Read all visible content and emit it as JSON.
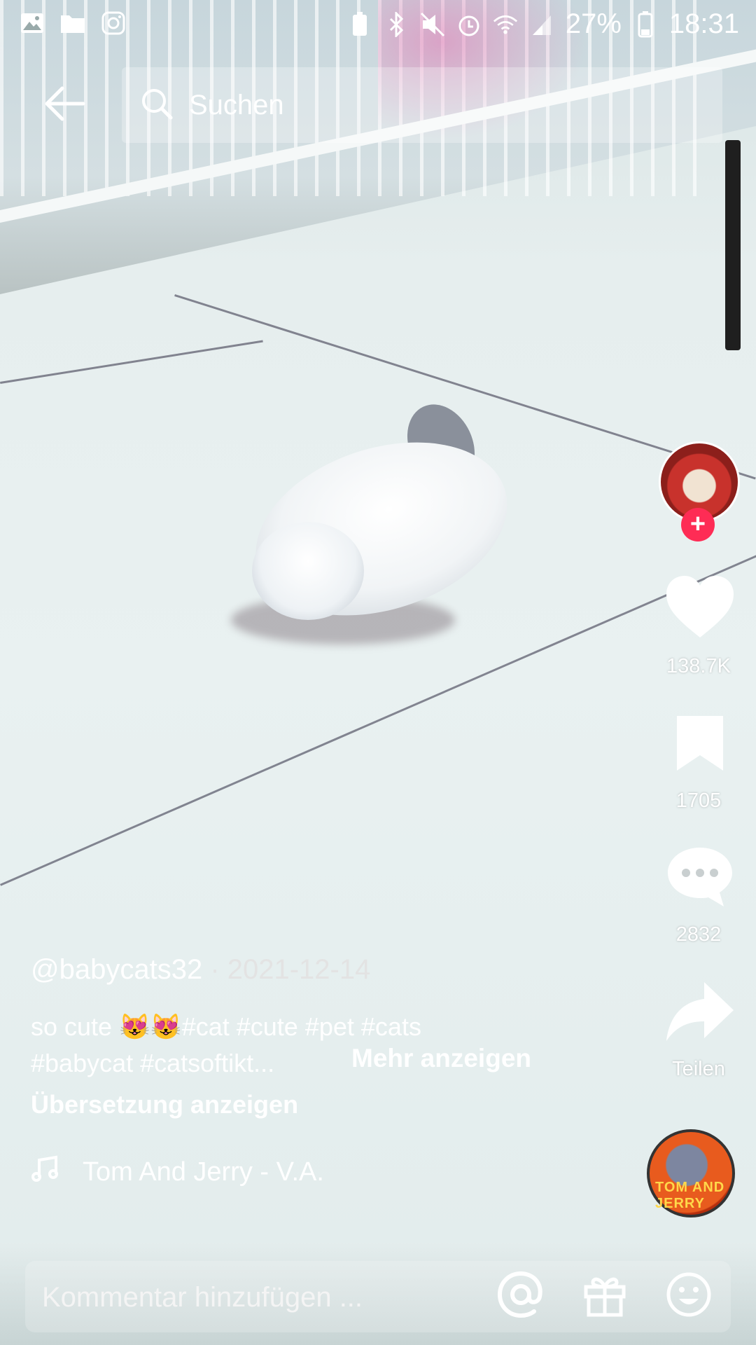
{
  "status_bar": {
    "battery": "27%",
    "time": "18:31",
    "left_icons": [
      "gallery-icon",
      "folder-icon",
      "instagram-icon"
    ],
    "right_icons": [
      "battery-saver-icon",
      "bluetooth-icon",
      "mute-icon",
      "alarm-icon",
      "wifi-icon",
      "signal-icon",
      "battery-icon"
    ]
  },
  "header": {
    "search_label": "Suchen"
  },
  "actions": {
    "likes": "138.7K",
    "saves": "1705",
    "comments": "2832",
    "share_label": "Teilen"
  },
  "post": {
    "username": "@babycats32",
    "separator": " · ",
    "date": "2021-12-14",
    "description_line1": "so cute 😻😻#cat #cute #pet #cats",
    "description_line2": "#babycat #catsoftikt...",
    "more_label": "Mehr anzeigen",
    "translate_label": "Übersetzung anzeigen",
    "sound": "Tom And Jerry -  V.A."
  },
  "music_disc_text": "TOM AND JERRY",
  "comment_bar": {
    "placeholder": "Kommentar hinzufügen ..."
  },
  "colors": {
    "accent": "#fe2c55",
    "text": "#ffffff"
  }
}
